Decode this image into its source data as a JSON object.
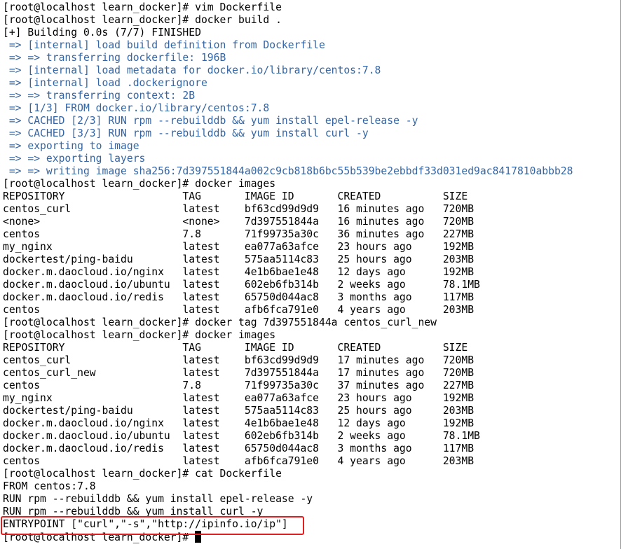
{
  "terminal": {
    "lines": [
      {
        "text": "[root@localhost learn_docker]# vim Dockerfile",
        "style": "plain"
      },
      {
        "text": "[root@localhost learn_docker]# docker build .",
        "style": "plain"
      },
      {
        "text": "[+] Building 0.0s (7/7) FINISHED",
        "style": "plain"
      },
      {
        "text": " => [internal] load build definition from Dockerfile",
        "style": "blue"
      },
      {
        "text": " => => transferring dockerfile: 196B",
        "style": "blue"
      },
      {
        "text": " => [internal] load metadata for docker.io/library/centos:7.8",
        "style": "blue"
      },
      {
        "text": " => [internal] load .dockerignore",
        "style": "blue"
      },
      {
        "text": " => => transferring context: 2B",
        "style": "blue"
      },
      {
        "text": " => [1/3] FROM docker.io/library/centos:7.8",
        "style": "blue"
      },
      {
        "text": " => CACHED [2/3] RUN rpm --rebuilddb && yum install epel-release -y",
        "style": "blue"
      },
      {
        "text": " => CACHED [3/3] RUN rpm --rebuilddb && yum install curl -y",
        "style": "blue"
      },
      {
        "text": " => exporting to image",
        "style": "blue"
      },
      {
        "text": " => => exporting layers",
        "style": "blue"
      },
      {
        "text": " => => writing image sha256:7d397551844a002c9cb818b6bc55b539be2ebbdf33d031ed9ac8417810abbb28",
        "style": "blue"
      },
      {
        "text": "[root@localhost learn_docker]# docker images",
        "style": "plain"
      },
      {
        "text": "REPOSITORY                   TAG       IMAGE ID       CREATED          SIZE",
        "style": "plain"
      },
      {
        "text": "centos_curl                  latest    bf63cd99d9d9   16 minutes ago   720MB",
        "style": "plain"
      },
      {
        "text": "<none>                       <none>    7d397551844a   16 minutes ago   720MB",
        "style": "plain"
      },
      {
        "text": "centos                       7.8       71f99735a30c   36 minutes ago   227MB",
        "style": "plain"
      },
      {
        "text": "my_nginx                     latest    ea077a63afce   23 hours ago     192MB",
        "style": "plain"
      },
      {
        "text": "dockertest/ping-baidu        latest    575aa5114c83   25 hours ago     203MB",
        "style": "plain"
      },
      {
        "text": "docker.m.daocloud.io/nginx   latest    4e1b6bae1e48   12 days ago      192MB",
        "style": "plain"
      },
      {
        "text": "docker.m.daocloud.io/ubuntu  latest    602eb6fb314b   2 weeks ago      78.1MB",
        "style": "plain"
      },
      {
        "text": "docker.m.daocloud.io/redis   latest    65750d044ac8   3 months ago     117MB",
        "style": "plain"
      },
      {
        "text": "centos                       latest    afb6fca791e0   4 years ago      203MB",
        "style": "plain"
      },
      {
        "text": "[root@localhost learn_docker]# docker tag 7d397551844a centos_curl_new",
        "style": "plain"
      },
      {
        "text": "[root@localhost learn_docker]# docker images",
        "style": "plain"
      },
      {
        "text": "REPOSITORY                   TAG       IMAGE ID       CREATED          SIZE",
        "style": "plain"
      },
      {
        "text": "centos_curl                  latest    bf63cd99d9d9   17 minutes ago   720MB",
        "style": "plain"
      },
      {
        "text": "centos_curl_new              latest    7d397551844a   17 minutes ago   720MB",
        "style": "plain"
      },
      {
        "text": "centos                       7.8       71f99735a30c   37 minutes ago   227MB",
        "style": "plain"
      },
      {
        "text": "my_nginx                     latest    ea077a63afce   23 hours ago     192MB",
        "style": "plain"
      },
      {
        "text": "dockertest/ping-baidu        latest    575aa5114c83   25 hours ago     203MB",
        "style": "plain"
      },
      {
        "text": "docker.m.daocloud.io/nginx   latest    4e1b6bae1e48   12 days ago      192MB",
        "style": "plain"
      },
      {
        "text": "docker.m.daocloud.io/ubuntu  latest    602eb6fb314b   2 weeks ago      78.1MB",
        "style": "plain"
      },
      {
        "text": "docker.m.daocloud.io/redis   latest    65750d044ac8   3 months ago     117MB",
        "style": "plain"
      },
      {
        "text": "centos                       latest    afb6fca791e0   4 years ago      203MB",
        "style": "plain"
      },
      {
        "text": "[root@localhost learn_docker]# cat Dockerfile",
        "style": "plain"
      },
      {
        "text": "FROM centos:7.8",
        "style": "plain"
      },
      {
        "text": "RUN rpm --rebuilddb && yum install epel-release -y",
        "style": "plain"
      },
      {
        "text": "RUN rpm --rebuilddb && yum install curl -y",
        "style": "plain"
      },
      {
        "text": "ENTRYPOINT [\"curl\",\"-s\",\"http://ipinfo.io/ip\"]",
        "style": "plain"
      }
    ],
    "prompt": "[root@localhost learn_docker]# ",
    "colors": {
      "background": "#ffffff",
      "text": "#000000",
      "output_blue": "#3465a4",
      "highlight_border": "#e02020"
    }
  }
}
